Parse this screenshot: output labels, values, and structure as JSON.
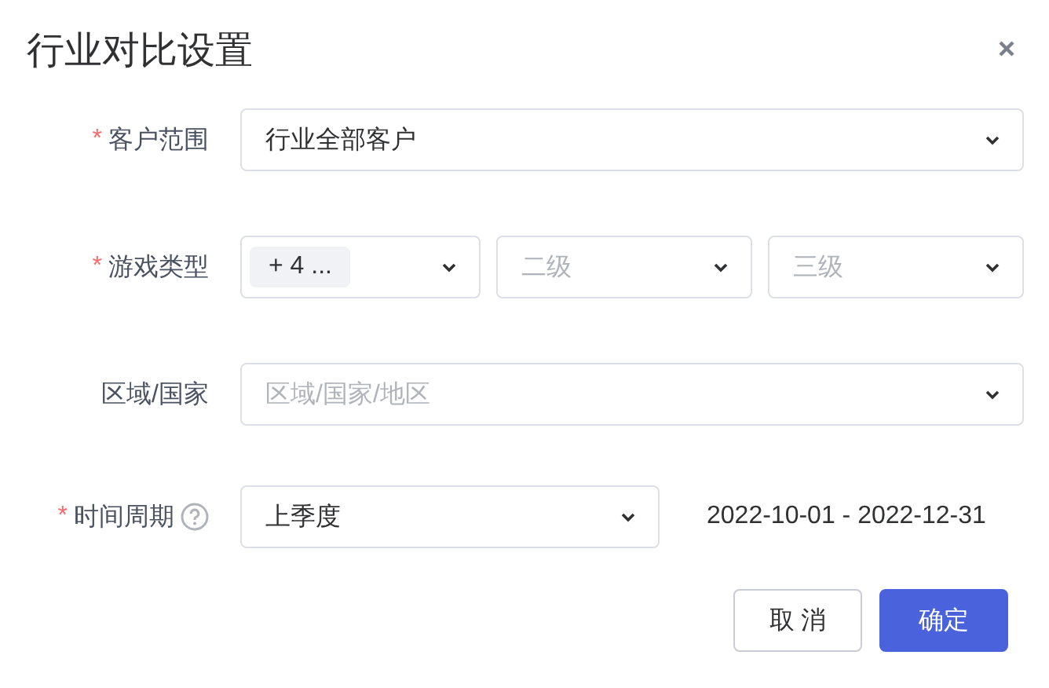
{
  "dialog": {
    "title": "行业对比设置"
  },
  "fields": [
    {
      "label": "客户范围",
      "required_mark": "*",
      "selects": [
        {
          "value": "行业全部客户"
        }
      ]
    },
    {
      "label": "游戏类型",
      "required_mark": "*",
      "selects": [
        {
          "tag": "+ 4 ..."
        },
        {
          "placeholder": "二级"
        },
        {
          "placeholder": "三级"
        }
      ]
    },
    {
      "label": "区域/国家",
      "selects": [
        {
          "placeholder": "区域/国家/地区"
        }
      ]
    },
    {
      "label": "时间周期",
      "required_mark": "*",
      "help": true,
      "selects": [
        {
          "value": "上季度"
        }
      ],
      "range": "2022-10-01 - 2022-12-31"
    }
  ],
  "buttons": [
    {
      "label": "取 消",
      "kind": "secondary"
    },
    {
      "label": "确定",
      "kind": "primary"
    }
  ]
}
